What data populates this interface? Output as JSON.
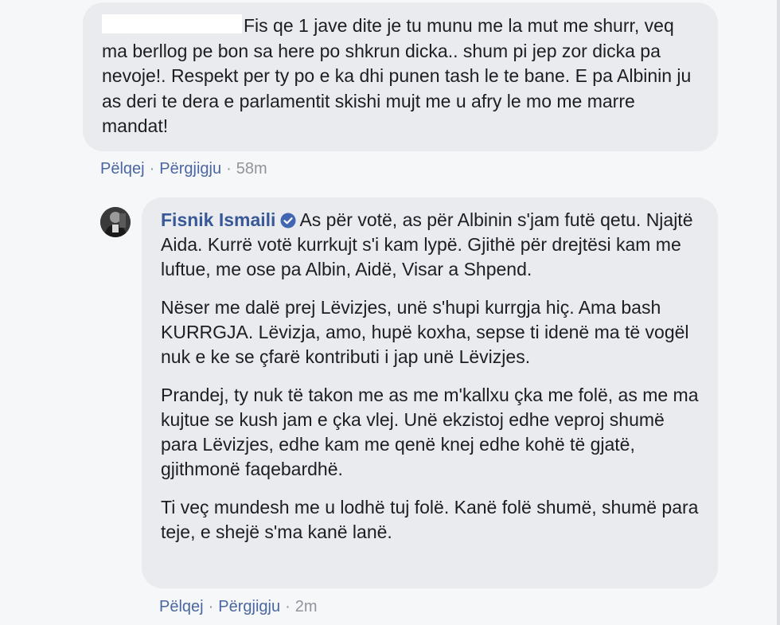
{
  "comments": [
    {
      "text": "Fis qe 1 jave dite je tu munu me la mut me shurr, veq ma berllog pe bon sa here po shkrun dicka.. shum pi jep zor dicka pa nevoje!. Respekt per ty po e ka dhi punen tash le te bane. E pa Albinin ju as deri te dera e parlamentit skishi mujt me u afry le mo me marre mandat!",
      "actions": {
        "like": "Pëlqej",
        "reply": "Përgjigju",
        "time": "58m"
      }
    },
    {
      "author": "Fisnik Ismaili",
      "verified_icon": "verified-badge-icon",
      "paragraphs": [
        "As për votë, as për Albinin s'jam futë qetu. Njajtë Aida. Kurrë votë kurrkujt s'i kam lypë. Gjithë për drejtësi kam me luftue, me ose pa Albin, Aidë, Visar a Shpend.",
        "Nëser me dalë prej Lëvizjes, unë s'hupi kurrgja hiç. Ama bash KURRGJA. Lëvizja, amo, hupë koxha, sepse ti idenë ma të vogël nuk e ke se çfarë kontributi i jap unë Lëvizjes.",
        "Prandej, ty nuk të takon me as me m'kallxu çka me folë, as me ma kujtue se kush jam e çka vlej. Unë ekzistoj edhe veproj shumë para Lëvizjes, edhe kam me qenë knej edhe kohë të gjatë, gjithmonë faqebardhë.",
        "Ti veç mundesh me u lodhë tuj folë. Kanë folë shumë, shumë para teje, e shejë s'ma kanë lanë."
      ],
      "actions": {
        "like": "Pëlqej",
        "reply": "Përgjigju",
        "time": "2m"
      }
    }
  ],
  "separator": "·",
  "colors": {
    "bubble": "#e9ebee",
    "link": "#4b67a1",
    "author": "#385898",
    "meta": "#90949c",
    "verified": "#4267b2"
  }
}
